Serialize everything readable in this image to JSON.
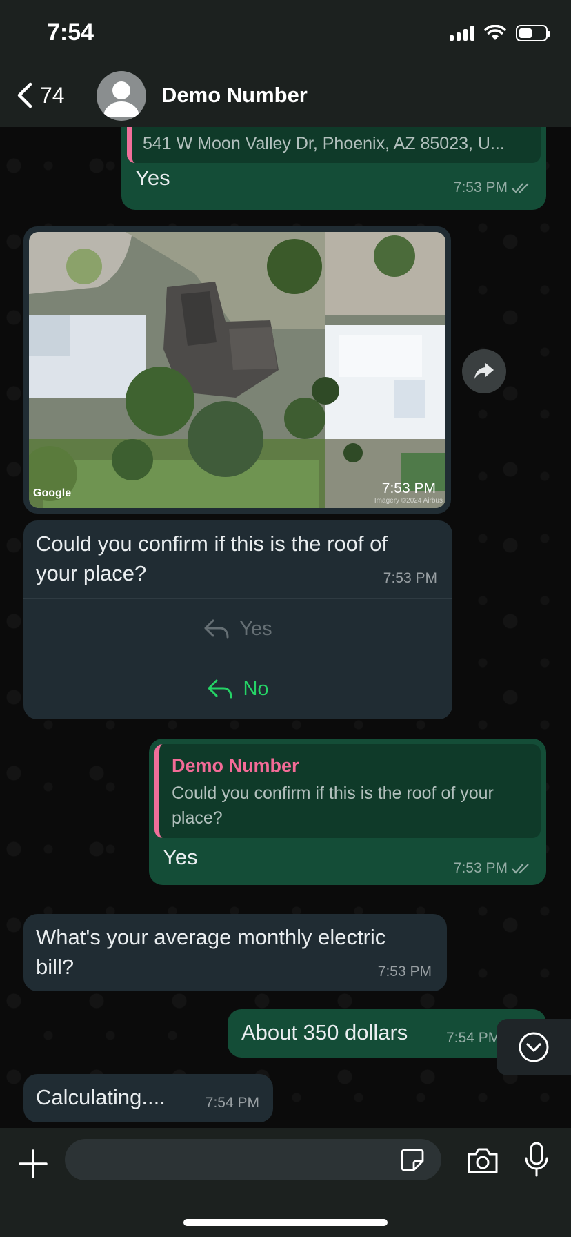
{
  "status_bar": {
    "time": "7:54"
  },
  "header": {
    "back_count": "74",
    "contact_name": "Demo Number"
  },
  "messages": {
    "m1": {
      "quote_text": "541 W Moon Valley Dr, Phoenix, AZ 85023, U...",
      "text": "Yes",
      "time": "7:53 PM"
    },
    "map": {
      "attribution": "Google",
      "imagery": "Imagery ©2024 Airbus",
      "time": "7:53 PM"
    },
    "m2": {
      "text": "Could you confirm if this is the roof of your place?",
      "time": "7:53 PM",
      "button_yes": "Yes",
      "button_no": "No"
    },
    "m3": {
      "quote_name": "Demo Number",
      "quote_text": "Could you confirm if this is the roof of your place?",
      "text": "Yes",
      "time": "7:53 PM"
    },
    "m4": {
      "text": "What's your average monthly electric bill?",
      "time": "7:53 PM"
    },
    "m5": {
      "text": "About 350 dollars",
      "time": "7:54 PM"
    },
    "m6": {
      "text": "Calculating....",
      "time": "7:54 PM"
    }
  },
  "colors": {
    "outgoing": "#144d37",
    "incoming": "#202c33",
    "accent_green": "#25d366",
    "quote_pink": "#f36b97"
  }
}
